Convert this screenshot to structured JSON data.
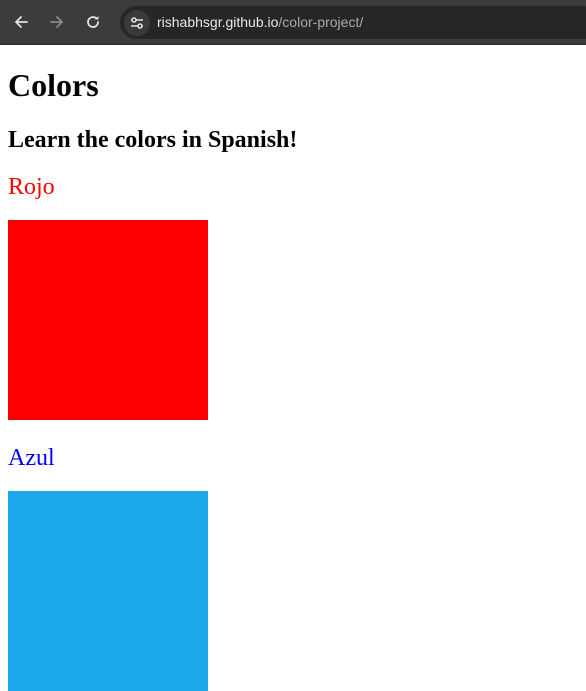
{
  "browser": {
    "url_host": "rishabhsgr.github.io",
    "url_path": "/color-project/",
    "back_icon": "arrow-left-icon",
    "forward_icon": "arrow-right-icon",
    "reload_icon": "reload-icon",
    "site_info_icon": "tune-icon"
  },
  "page": {
    "title": "Colors",
    "subtitle": "Learn the colors in Spanish!",
    "colors": [
      {
        "name": "Rojo",
        "text_color": "#ff0000",
        "swatch_color": "#ff0000"
      },
      {
        "name": "Azul",
        "text_color": "#0000ff",
        "swatch_color": "#1ca8ed"
      }
    ]
  }
}
